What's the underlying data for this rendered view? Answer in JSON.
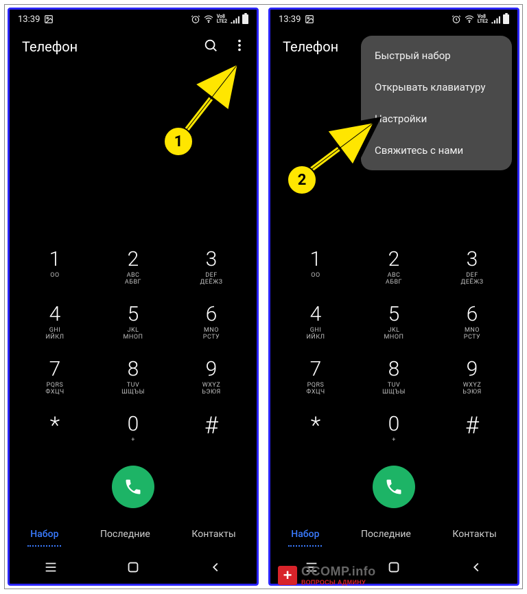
{
  "status": {
    "time": "13:39"
  },
  "header": {
    "title": "Телефон"
  },
  "dialpad": [
    [
      {
        "n": "1",
        "s": "ОО"
      },
      {
        "n": "2",
        "s": "ABC\nАБВГ"
      },
      {
        "n": "3",
        "s": "DEF\nДЕЁЖЗ"
      }
    ],
    [
      {
        "n": "4",
        "s": "GHI\nИЙКЛ"
      },
      {
        "n": "5",
        "s": "JKL\nМНОП"
      },
      {
        "n": "6",
        "s": "MNO\nРСТУ"
      }
    ],
    [
      {
        "n": "7",
        "s": "PQRS\nФХЦЧ"
      },
      {
        "n": "8",
        "s": "TUV\nШЩЪЫ"
      },
      {
        "n": "9",
        "s": "WXYZ\nЬЭЮЯ"
      }
    ],
    [
      {
        "n": "*",
        "s": ""
      },
      {
        "n": "0",
        "s": "+"
      },
      {
        "n": "#",
        "s": ""
      }
    ]
  ],
  "tabs": {
    "dial": "Набор",
    "recent": "Последние",
    "contacts": "Контакты"
  },
  "menu": {
    "speed_dial": "Быстрый набор",
    "open_keyboard": "Открывать клавиатуру",
    "settings": "Настройки",
    "contact_us": "Свяжитесь с нами"
  },
  "annotations": {
    "step1": "1",
    "step2": "2"
  },
  "watermark": {
    "brand_main": "OCOMP",
    "brand_suffix": ".info",
    "tagline": "ВОПРОСЫ АДМИНУ"
  }
}
